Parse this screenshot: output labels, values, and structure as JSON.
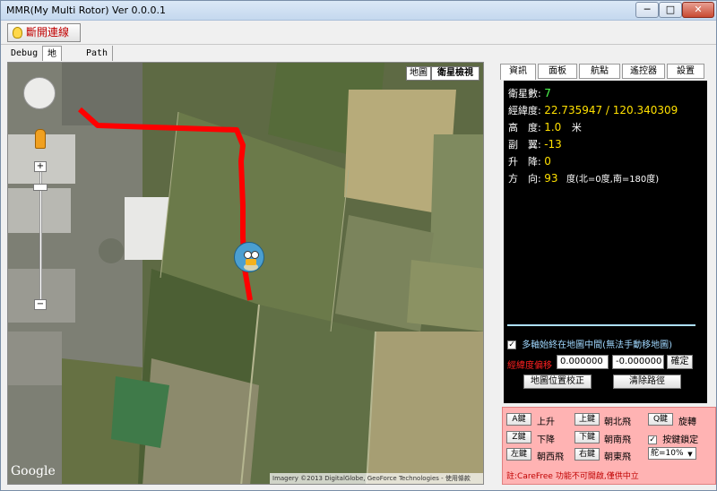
{
  "window": {
    "title": "MMR(My Multi Rotor) Ver 0.0.0.1",
    "controls": {
      "minimize": "─",
      "maximize": "□",
      "close": "✕"
    }
  },
  "toolbar": {
    "connect_label": "斷開連線"
  },
  "left_tabs": [
    {
      "label": "Debug"
    },
    {
      "label": "地圖"
    },
    {
      "label": "Path log"
    }
  ],
  "map": {
    "type_buttons": [
      {
        "label": "地圖"
      },
      {
        "label": "衛星檢視"
      }
    ],
    "active_type": "衛星檢視",
    "zoom_in": "+",
    "zoom_out": "−",
    "logo": "Google",
    "attribution": "Imagery ©2013 DigitalGlobe, GeoForce Technologies - 使用條款"
  },
  "right_tabs": [
    {
      "label": "資訊"
    },
    {
      "label": "面板"
    },
    {
      "label": "航點"
    },
    {
      "label": "遙控器"
    },
    {
      "label": "設置"
    }
  ],
  "info": {
    "satellites_label": "衛星數:",
    "satellites_value": "7",
    "latlon_label": "經緯度:",
    "latlon_value": "22.735947 / 120.340309",
    "altitude_label": "高　度:",
    "altitude_value": "1.0",
    "altitude_unit": "米",
    "roll_label": "副　翼:",
    "roll_value": "-13",
    "climb_label": "升　降:",
    "climb_value": "0",
    "heading_label": "方　向:",
    "heading_value": "93",
    "heading_note": "度(北=0度,南=180度)",
    "center_check_label": "多軸始終在地圖中間(無法手動移地圖)",
    "center_checked": true,
    "offset_label": "經緯度偏移",
    "offset_lat": "0.000000",
    "offset_lon": "-0.000000",
    "confirm_label": "確定",
    "calibrate_label": "地圖位置校正",
    "clear_path_label": "清除路徑"
  },
  "keys": {
    "a_key": "A鍵",
    "a_action": "上升",
    "z_key": "Z鍵",
    "z_action": "下降",
    "left_key": "左鍵",
    "left_action": "朝西飛",
    "up_key": "上鍵",
    "up_action": "朝北飛",
    "down_key": "下鍵",
    "down_action": "朝南飛",
    "right_key": "右鍵",
    "right_action": "朝東飛",
    "q_key": "Q鍵",
    "q_action": "旋轉",
    "lock_label": "按鍵鎖定",
    "lock_checked": true,
    "speed_value": "舵=10%",
    "note": "註:CareFree 功能不可開啟,僅供中立"
  },
  "colors": {
    "path": "#ff0000",
    "info_bg": "#000000",
    "value": "#ffe000",
    "keypanel_bg": "#ffb3b3"
  }
}
